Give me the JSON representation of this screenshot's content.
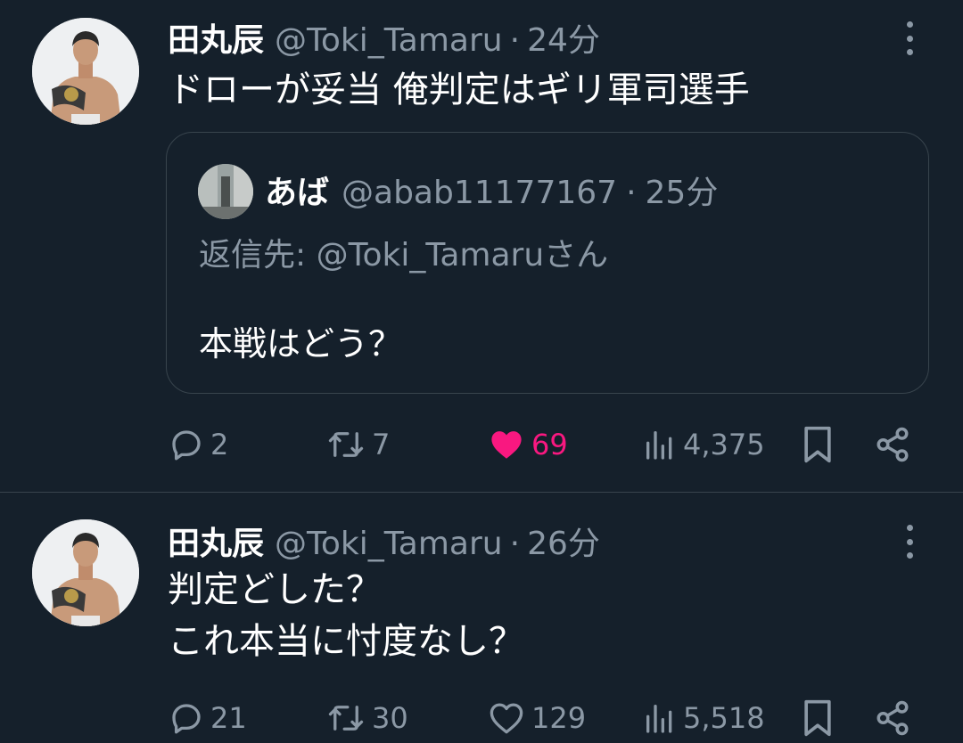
{
  "tweets": [
    {
      "name": "田丸辰",
      "handle": "@Toki_Tamaru",
      "separator": "·",
      "time": "24分",
      "text": "ドローが妥当 俺判定はギリ軍司選手",
      "quote": {
        "name": "あば",
        "handle": "@abab11177167",
        "separator": "·",
        "time": "25分",
        "replying_to": "返信先: @Toki_Tamaruさん",
        "text": "本戦はどう？"
      },
      "actions": {
        "replies": "2",
        "retweets": "7",
        "likes": "69",
        "liked": true,
        "views": "4,375"
      }
    },
    {
      "name": "田丸辰",
      "handle": "@Toki_Tamaru",
      "separator": "·",
      "time": "26分",
      "text": "判定どした？\nこれ本当に忖度なし？",
      "actions": {
        "replies": "21",
        "retweets": "30",
        "likes": "129",
        "liked": false,
        "views": "5,518"
      }
    }
  ],
  "icons": {
    "reply": "reply-icon",
    "retweet": "retweet-icon",
    "like": "heart-icon",
    "views": "views-icon",
    "bookmark": "bookmark-icon",
    "share": "share-icon",
    "more": "more-options-icon"
  },
  "colors": {
    "background": "#15202b",
    "secondary_text": "#8b98a5",
    "like_active": "#f91880",
    "border": "#38444d"
  }
}
